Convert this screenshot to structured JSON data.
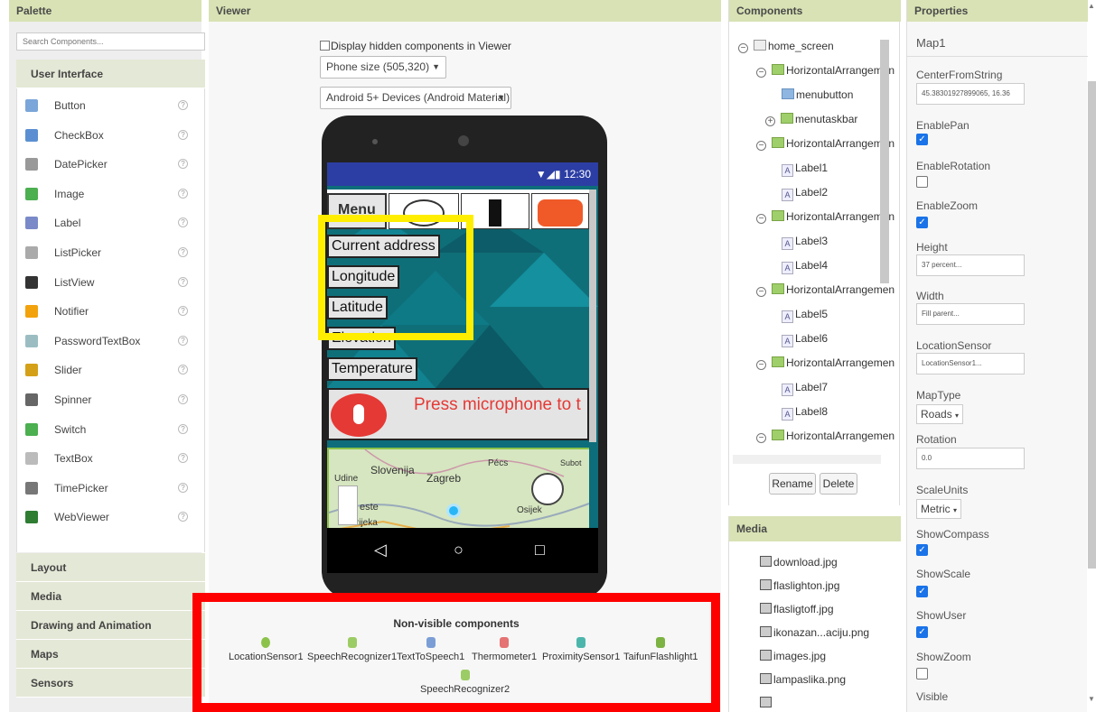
{
  "palette": {
    "title": "Palette",
    "search_placeholder": "Search Components...",
    "category_open": "User Interface",
    "items": [
      {
        "label": "Button",
        "icon": "button-icon",
        "color": "#7aa6d9"
      },
      {
        "label": "CheckBox",
        "icon": "checkbox-icon",
        "color": "#5b8fd1"
      },
      {
        "label": "DatePicker",
        "icon": "datepicker-icon",
        "color": "#999"
      },
      {
        "label": "Image",
        "icon": "image-icon",
        "color": "#4caf50"
      },
      {
        "label": "Label",
        "icon": "label-icon",
        "color": "#7a8ac8"
      },
      {
        "label": "ListPicker",
        "icon": "listpicker-icon",
        "color": "#aaa"
      },
      {
        "label": "ListView",
        "icon": "listview-icon",
        "color": "#333"
      },
      {
        "label": "Notifier",
        "icon": "notifier-icon",
        "color": "#f2a20c"
      },
      {
        "label": "PasswordTextBox",
        "icon": "passwordtextbox-icon",
        "color": "#9bbdc2"
      },
      {
        "label": "Slider",
        "icon": "slider-icon",
        "color": "#d4a017"
      },
      {
        "label": "Spinner",
        "icon": "spinner-icon",
        "color": "#666"
      },
      {
        "label": "Switch",
        "icon": "switch-icon",
        "color": "#4caf50"
      },
      {
        "label": "TextBox",
        "icon": "textbox-icon",
        "color": "#bbb"
      },
      {
        "label": "TimePicker",
        "icon": "timepicker-icon",
        "color": "#777"
      },
      {
        "label": "WebViewer",
        "icon": "webviewer-icon",
        "color": "#2e7d32"
      }
    ],
    "help_glyph": "?",
    "other_categories": [
      "Layout",
      "Media",
      "Drawing and Animation",
      "Maps",
      "Sensors"
    ]
  },
  "viewer": {
    "title": "Viewer",
    "hidden_checkbox_label": "Display hidden components in Viewer",
    "size_select": "Phone size (505,320)",
    "theme_select": "Android 5+ Devices (Android Material)",
    "clock": "12:30",
    "menu_label": "Menu",
    "labels": [
      "Current address",
      "Longitude",
      "Latitude",
      "Elevation",
      "Temperature"
    ],
    "mic_prompt": "Press microphone to t",
    "map_places": [
      "Slovenija",
      "Zagreb",
      "Pécs",
      "Udine",
      "este",
      "Rijeka",
      "Osijek",
      "Subot"
    ],
    "nonvisible_title": "Non-visible components",
    "nonvisible": [
      {
        "label": "LocationSensor1",
        "color": "#8bc34a"
      },
      {
        "label": "SpeechRecognizer1",
        "color": "#9ccc65"
      },
      {
        "label": "TextToSpeech1",
        "color": "#7b9ed6"
      },
      {
        "label": "Thermometer1",
        "color": "#e57373"
      },
      {
        "label": "ProximitySensor1",
        "color": "#4db6ac"
      },
      {
        "label": "TaifunFlashlight1",
        "color": "#7cb342"
      },
      {
        "label": "SpeechRecognizer2",
        "color": "#9ccc65"
      }
    ]
  },
  "components": {
    "title": "Components",
    "tree": [
      {
        "label": "home_screen",
        "toggle": "⊟",
        "kind": "screen"
      },
      {
        "label": "HorizontalArrangemen",
        "toggle": "⊟",
        "kind": "arr"
      },
      {
        "label": "menubutton",
        "toggle": "",
        "kind": "btn"
      },
      {
        "label": "menutaskbar",
        "toggle": "⊞",
        "kind": "arr"
      },
      {
        "label": "HorizontalArrangemen",
        "toggle": "⊟",
        "kind": "arr"
      },
      {
        "label": "Label1",
        "toggle": "",
        "kind": "label"
      },
      {
        "label": "Label2",
        "toggle": "",
        "kind": "label"
      },
      {
        "label": "HorizontalArrangemen",
        "toggle": "⊟",
        "kind": "arr"
      },
      {
        "label": "Label3",
        "toggle": "",
        "kind": "label"
      },
      {
        "label": "Label4",
        "toggle": "",
        "kind": "label"
      },
      {
        "label": "HorizontalArrangemen",
        "toggle": "⊟",
        "kind": "arr"
      },
      {
        "label": "Label5",
        "toggle": "",
        "kind": "label"
      },
      {
        "label": "Label6",
        "toggle": "",
        "kind": "label"
      },
      {
        "label": "HorizontalArrangemen",
        "toggle": "⊟",
        "kind": "arr"
      },
      {
        "label": "Label7",
        "toggle": "",
        "kind": "label"
      },
      {
        "label": "Label8",
        "toggle": "",
        "kind": "label"
      },
      {
        "label": "HorizontalArrangemen",
        "toggle": "⊟",
        "kind": "arr"
      }
    ],
    "rename_label": "Rename",
    "delete_label": "Delete"
  },
  "media": {
    "title": "Media",
    "files": [
      "download.jpg",
      "flaslighton.jpg",
      "flasligtoff.jpg",
      "ikonazan...aciju.png",
      "images.jpg",
      "lampaslika.png"
    ]
  },
  "properties": {
    "title": "Properties",
    "component": "Map1",
    "center_label": "CenterFromString",
    "center_value": "45.38301927899065, 16.36",
    "enable_pan": "EnablePan",
    "enable_rotation": "EnableRotation",
    "enable_zoom": "EnableZoom",
    "height_label": "Height",
    "height_value": "37 percent...",
    "width_label": "Width",
    "width_value": "Fill parent...",
    "location_sensor_label": "LocationSensor",
    "location_sensor_value": "LocationSensor1...",
    "map_type_label": "MapType",
    "map_type_value": "Roads",
    "rotation_label": "Rotation",
    "rotation_value": "0.0",
    "scale_units_label": "ScaleUnits",
    "scale_units_value": "Metric",
    "show_compass": "ShowCompass",
    "show_scale": "ShowScale",
    "show_user": "ShowUser",
    "show_zoom": "ShowZoom",
    "visible": "Visible",
    "checked": {
      "EnablePan": true,
      "EnableRotation": false,
      "EnableZoom": true,
      "ShowCompass": true,
      "ShowScale": true,
      "ShowUser": true,
      "ShowZoom": false
    }
  }
}
